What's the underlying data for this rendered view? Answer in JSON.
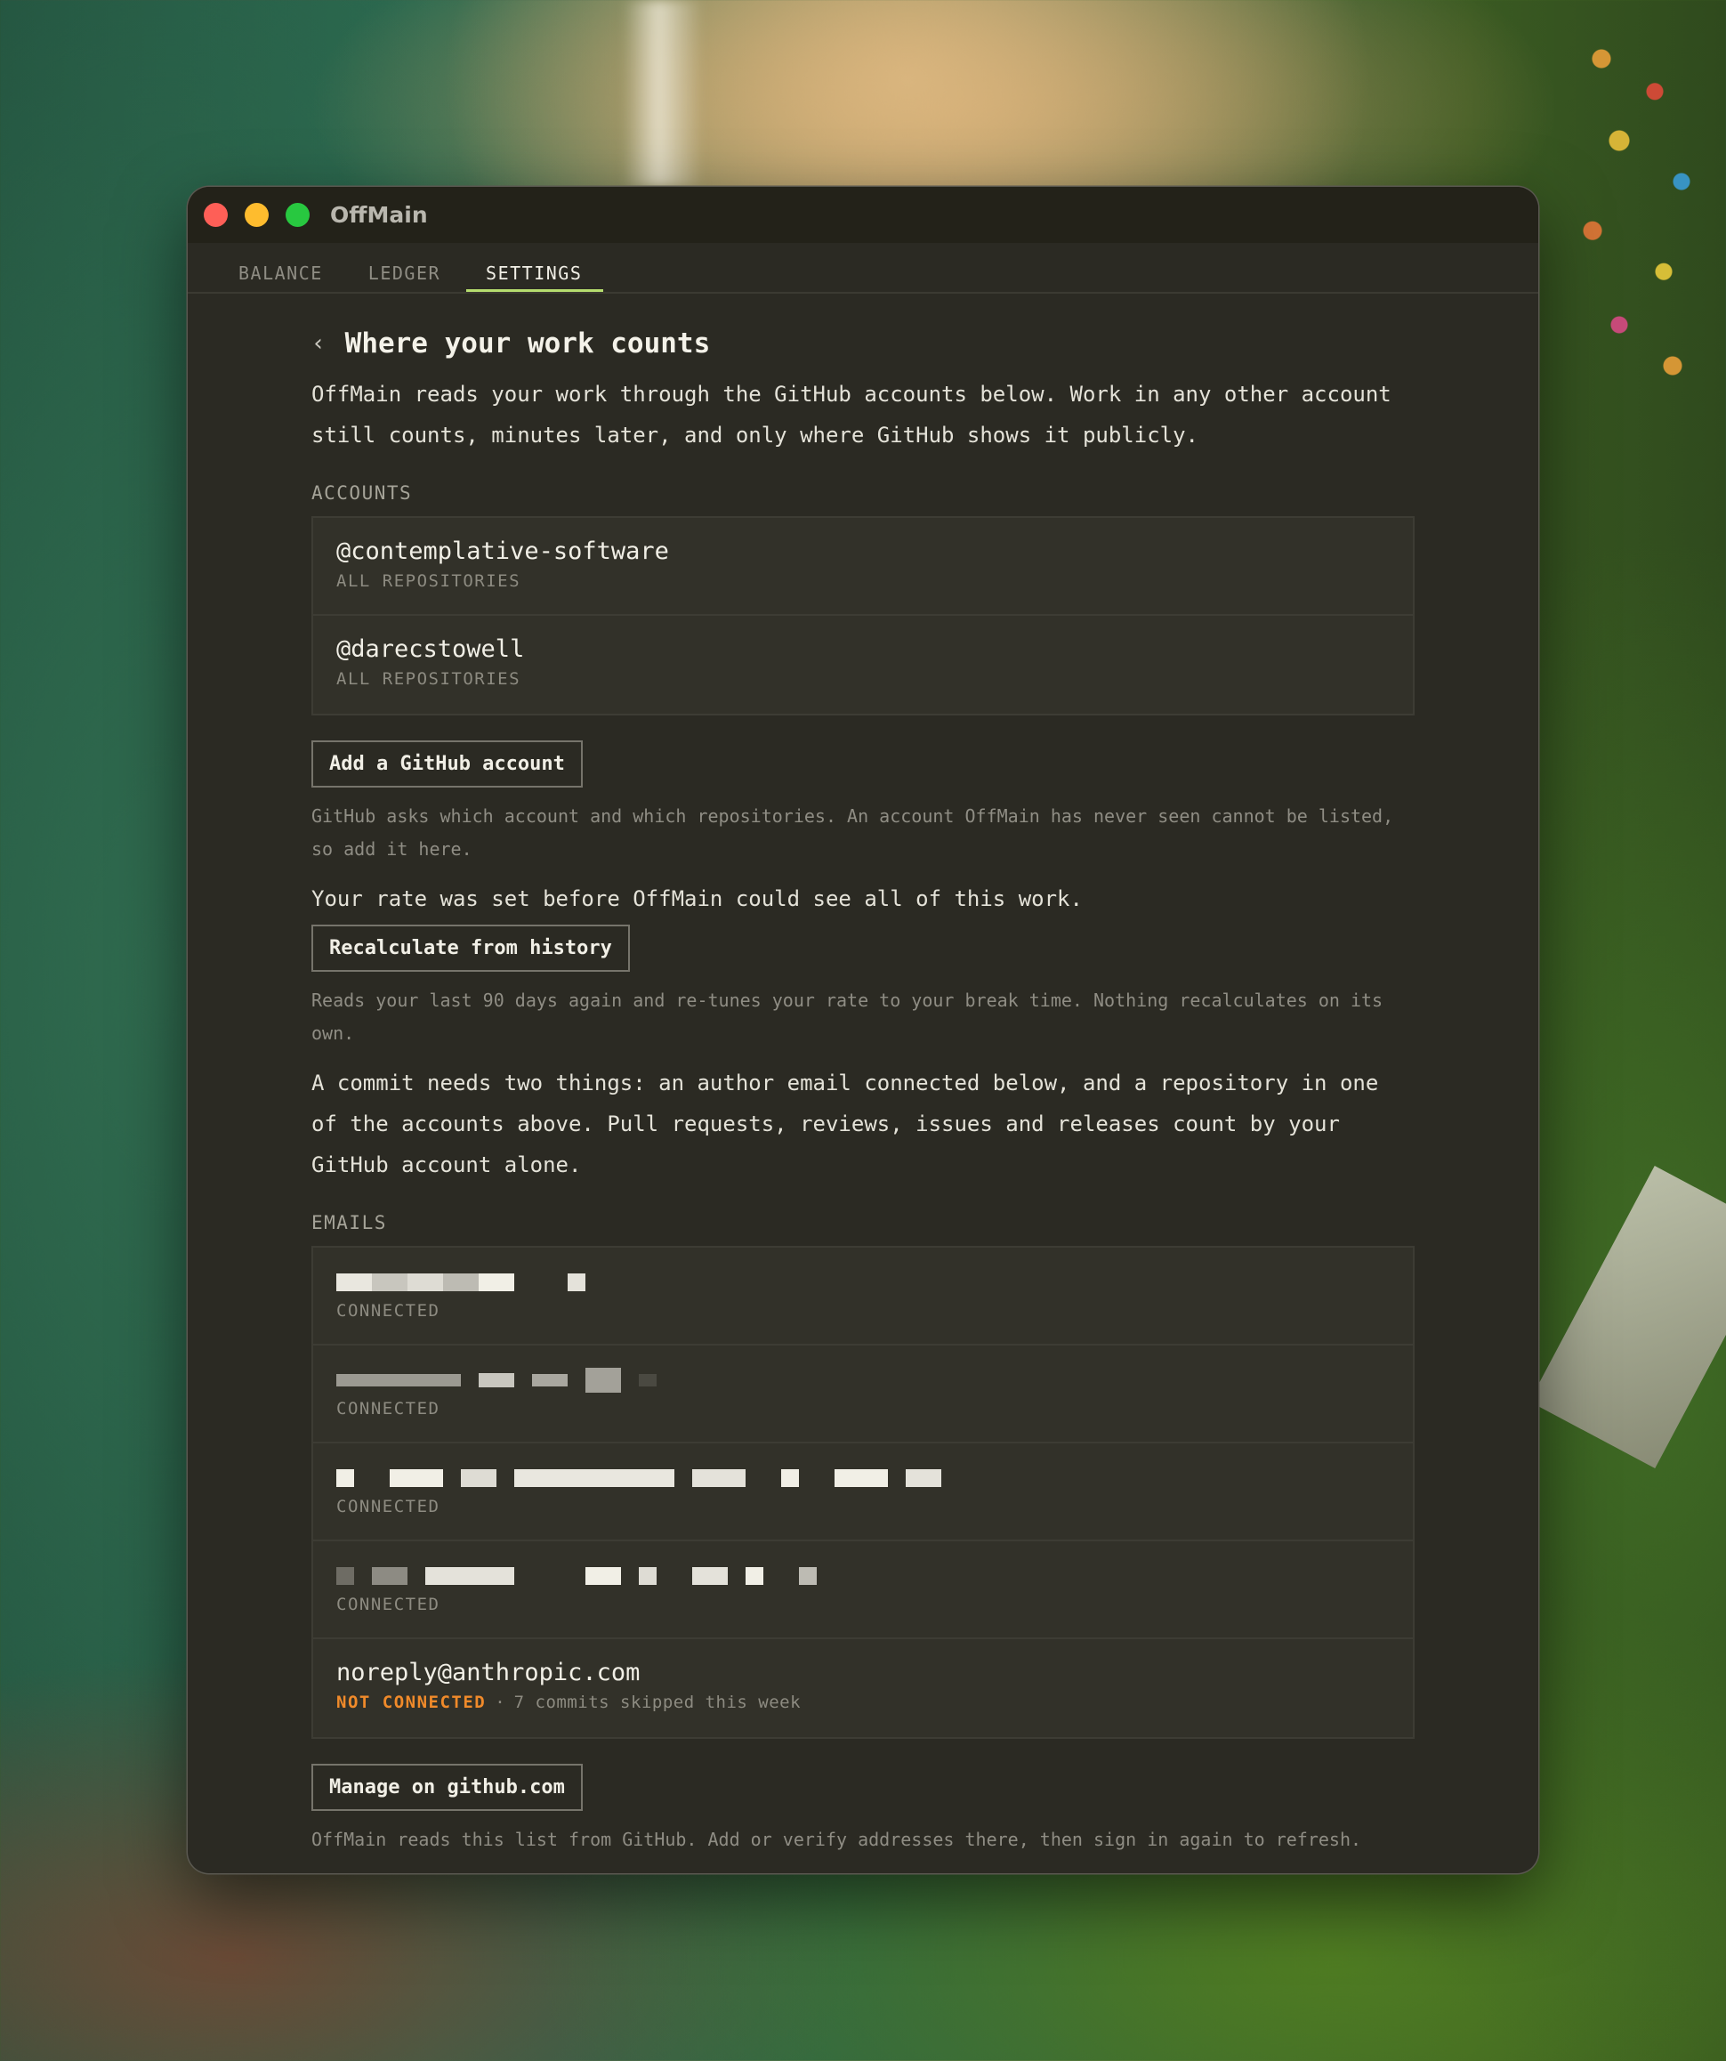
{
  "window": {
    "title": "OffMain"
  },
  "tabs": [
    {
      "label": "BALANCE"
    },
    {
      "label": "LEDGER"
    },
    {
      "label": "SETTINGS"
    }
  ],
  "page": {
    "back_glyph": "‹",
    "title": "Where your work counts",
    "lead": "OffMain reads your work through the GitHub accounts below. Work in any other account still counts, minutes later, and only where GitHub shows it publicly."
  },
  "accounts": {
    "label": "ACCOUNTS",
    "items": [
      {
        "name": "@contemplative-software",
        "scope": "ALL REPOSITORIES"
      },
      {
        "name": "@darecstowell",
        "scope": "ALL REPOSITORIES"
      }
    ],
    "add_button": "Add a GitHub account",
    "help": "GitHub asks which account and which repositories. An account OffMain has never seen cannot be listed, so add it here."
  },
  "rate": {
    "text": "Your rate was set before OffMain could see all of this work.",
    "button": "Recalculate from history",
    "help": "Reads your last 90 days again and re-tunes your rate to your break time. Nothing recalculates on its own."
  },
  "commit_note": "A commit needs two things: an author email connected below, and a repository in one of the accounts above. Pull requests, reviews, issues and releases count by your GitHub account alone.",
  "emails": {
    "label": "EMAILS",
    "items": [
      {
        "status": "CONNECTED"
      },
      {
        "status": "CONNECTED"
      },
      {
        "status": "CONNECTED"
      },
      {
        "status": "CONNECTED"
      },
      {
        "address": "noreply@anthropic.com",
        "status": "NOT CONNECTED",
        "separator": "·",
        "note": "7 commits skipped this week"
      }
    ],
    "manage_button": "Manage on github.com",
    "help": "OffMain reads this list from GitHub. Add or verify addresses there, then sign in again to refresh."
  },
  "colors": {
    "accent_tab_underline": "#b6dd6e",
    "warning": "#f08a2a",
    "window_bg": "#2b2a23"
  }
}
